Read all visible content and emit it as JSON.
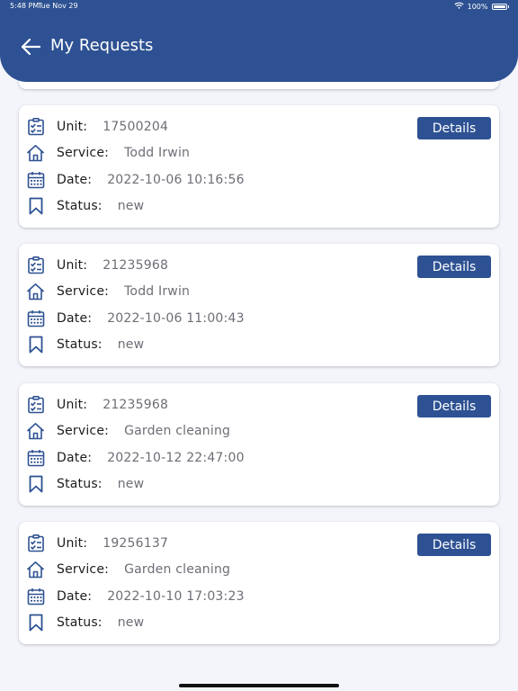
{
  "status_bar": {
    "time": "5:48 PM",
    "date": "Tue Nov 29",
    "battery": "100%"
  },
  "header": {
    "title": "My Requests"
  },
  "labels": {
    "unit": "Unit:",
    "service": "Service:",
    "date": "Date:",
    "status": "Status:"
  },
  "details_label": "Details",
  "requests": [
    {
      "unit": "17500204",
      "service": "Todd Irwin",
      "date": "2022-10-06 10:16:56",
      "status": "new"
    },
    {
      "unit": "21235968",
      "service": "Todd Irwin",
      "date": "2022-10-06 11:00:43",
      "status": "new"
    },
    {
      "unit": "21235968",
      "service": "Garden cleaning",
      "date": "2022-10-12 22:47:00",
      "status": "new"
    },
    {
      "unit": "19256137",
      "service": "Garden cleaning",
      "date": "2022-10-10 17:03:23",
      "status": "new"
    }
  ],
  "icons": {
    "unit": "clipboard-check-icon",
    "service": "home-icon",
    "date": "calendar-icon",
    "status": "bookmark-icon",
    "back": "arrow-left-icon"
  },
  "colors": {
    "primary": "#2d5192",
    "background": "#f3f5fb",
    "label": "#1c1c1c",
    "value": "#6d6d76"
  }
}
